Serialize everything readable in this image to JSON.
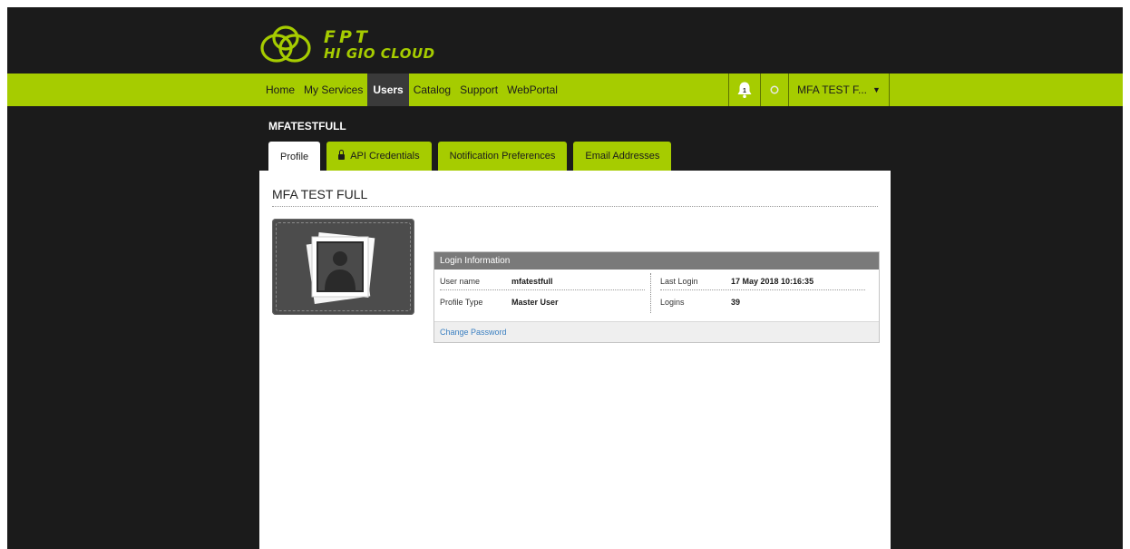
{
  "brand": {
    "line1": "FPT",
    "line2": "HI GIO CLOUD",
    "color": "#a6cc00"
  },
  "nav": {
    "items": [
      {
        "label": "Home",
        "active": false
      },
      {
        "label": "My Services",
        "active": false
      },
      {
        "label": "Users",
        "active": true
      },
      {
        "label": "Catalog",
        "active": false
      },
      {
        "label": "Support",
        "active": false
      },
      {
        "label": "WebPortal",
        "active": false
      }
    ],
    "notification_count": "1",
    "user_menu_label": "MFA TEST F...",
    "icons": {
      "bell": "bell-icon",
      "status": "check-circle-icon",
      "caret": "caret-down-icon"
    }
  },
  "account": {
    "title": "MFATESTFULL"
  },
  "tabs": [
    {
      "label": "Profile",
      "active": true
    },
    {
      "label": "API Credentials",
      "active": false,
      "icon": "lock-icon"
    },
    {
      "label": "Notification Preferences",
      "active": false
    },
    {
      "label": "Email Addresses",
      "active": false
    }
  ],
  "profile": {
    "full_name": "MFA TEST FULL",
    "avatar_icon": "user-silhouette-icon",
    "login_info": {
      "header": "Login Information",
      "user_name_label": "User name",
      "user_name_value": "mfatestfull",
      "profile_type_label": "Profile Type",
      "profile_type_value": "Master User",
      "last_login_label": "Last Login",
      "last_login_value": "17 May 2018 10:16:35",
      "logins_label": "Logins",
      "logins_value": "39"
    },
    "change_password_label": "Change Password"
  }
}
